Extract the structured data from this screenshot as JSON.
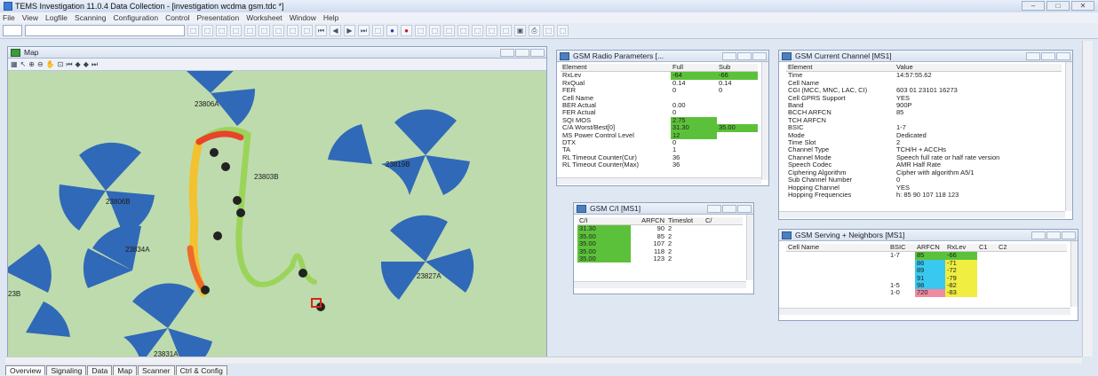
{
  "window": {
    "title": "TEMS Investigation 11.0.4 Data Collection - [investigation wcdma gsm.tdc *]"
  },
  "menu": [
    "File",
    "View",
    "Logfile",
    "Scanning",
    "Configuration",
    "Control",
    "Presentation",
    "Worksheet",
    "Window",
    "Help"
  ],
  "map": {
    "title": "Map",
    "cell_labels": [
      "23806A",
      "23819B",
      "23803B",
      "23806B",
      "23834A",
      "23827A",
      "23831A",
      "23B"
    ]
  },
  "radio": {
    "title": "GSM Radio Parameters [...",
    "columns": [
      "Element",
      "Full",
      "Sub"
    ],
    "rows": [
      [
        "RxLev",
        "-64",
        "-66"
      ],
      [
        "RxQual",
        "0.14",
        "0.14"
      ],
      [
        "FER",
        "0",
        "0"
      ],
      [
        "Cell Name",
        "",
        ""
      ],
      [
        "BER Actual",
        "0.00",
        ""
      ],
      [
        "FER Actual",
        "0",
        ""
      ],
      [
        "SQI MOS",
        "2.75",
        ""
      ],
      [
        "C/A Worst/Best[0]",
        "31.30",
        "35.00"
      ],
      [
        "MS Power Control Level",
        "12",
        ""
      ],
      [
        "DTX",
        "0",
        ""
      ],
      [
        "TA",
        "1",
        ""
      ],
      [
        "RL Timeout Counter(Cur)",
        "36",
        ""
      ],
      [
        "RL Timeout Counter(Max)",
        "36",
        ""
      ]
    ]
  },
  "current": {
    "title": "GSM Current Channel [MS1]",
    "columns": [
      "Element",
      "Value"
    ],
    "rows": [
      [
        "Time",
        "14:57:55.62"
      ],
      [
        "Cell Name",
        ""
      ],
      [
        "CGI (MCC, MNC, LAC, CI)",
        "603 01 23101 16273"
      ],
      [
        "Cell GPRS Support",
        "YES"
      ],
      [
        "Band",
        "900P"
      ],
      [
        "BCCH ARFCN",
        "85"
      ],
      [
        "TCH ARFCN",
        ""
      ],
      [
        "BSIC",
        "1-7"
      ],
      [
        "Mode",
        "Dedicated"
      ],
      [
        "Time Slot",
        "2"
      ],
      [
        "Channel Type",
        "TCH/H + ACCHs"
      ],
      [
        "Channel Mode",
        "Speech full rate or half rate version"
      ],
      [
        "Speech Codec",
        "AMR Half Rate"
      ],
      [
        "Ciphering Algorithm",
        "Cipher with algorithm A5/1"
      ],
      [
        "Sub Channel Number",
        "0"
      ],
      [
        "Hopping Channel",
        "YES"
      ],
      [
        "Hopping Frequencies",
        "h: 85 90 107 118 123"
      ]
    ]
  },
  "ci": {
    "title": "GSM C/I [MS1]",
    "columns": [
      "C/I",
      "ARFCN",
      "Timeslot",
      "C/"
    ],
    "rows": [
      [
        "31.30",
        "90",
        "2"
      ],
      [
        "35.00",
        "85",
        "2"
      ],
      [
        "35.00",
        "107",
        "2"
      ],
      [
        "35.00",
        "118",
        "2"
      ],
      [
        "35.00",
        "123",
        "2"
      ]
    ]
  },
  "neighbors": {
    "title": "GSM Serving + Neighbors [MS1]",
    "columns": [
      "Cell Name",
      "BSIC",
      "ARFCN",
      "RxLev",
      "C1",
      "C2"
    ],
    "rows": [
      {
        "bsic": "1-7",
        "arfcn": "85",
        "rxlev": "-66",
        "arfcn_color": "g",
        "rxlev_color": "g"
      },
      {
        "bsic": "",
        "arfcn": "86",
        "rxlev": "-71",
        "arfcn_color": "cy",
        "rxlev_color": "yl"
      },
      {
        "bsic": "",
        "arfcn": "89",
        "rxlev": "-72",
        "arfcn_color": "cy",
        "rxlev_color": "yl"
      },
      {
        "bsic": "",
        "arfcn": "91",
        "rxlev": "-79",
        "arfcn_color": "cy",
        "rxlev_color": "yl"
      },
      {
        "bsic": "1-5",
        "arfcn": "98",
        "rxlev": "-82",
        "arfcn_color": "cy",
        "rxlev_color": "yl"
      },
      {
        "bsic": "1-0",
        "arfcn": "720",
        "rxlev": "-83",
        "arfcn_color": "pk",
        "rxlev_color": "yl"
      }
    ]
  },
  "tabs": [
    "Overview",
    "Signaling",
    "Data",
    "Map",
    "Scanner",
    "Ctrl & Config"
  ]
}
